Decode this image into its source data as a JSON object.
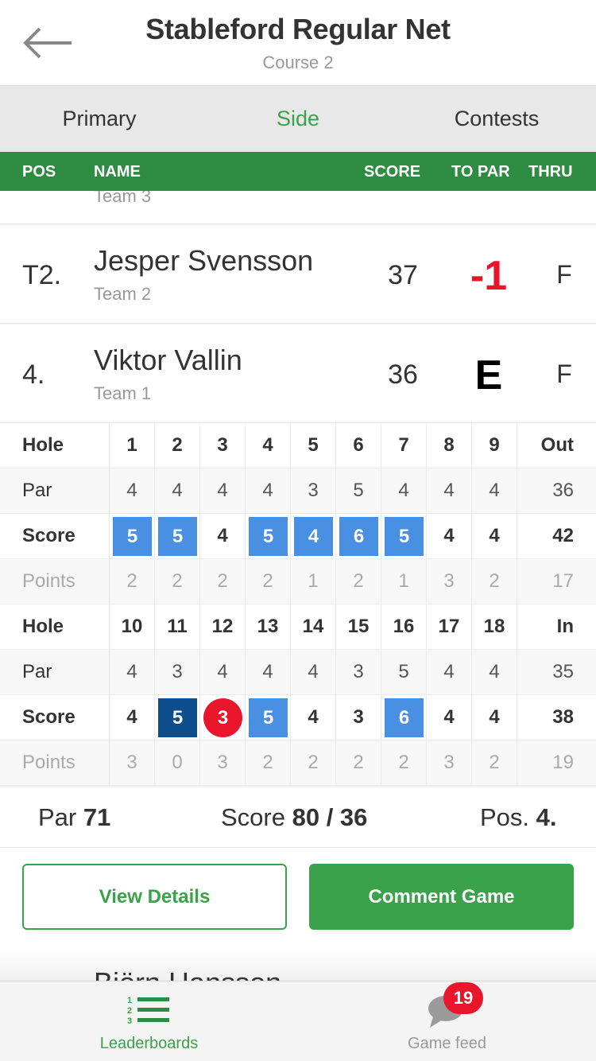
{
  "header": {
    "title": "Stableford Regular Net",
    "subtitle": "Course 2"
  },
  "tabs": [
    {
      "label": "Primary",
      "active": false
    },
    {
      "label": "Side",
      "active": true
    },
    {
      "label": "Contests",
      "active": false
    }
  ],
  "columns": {
    "pos": "POS",
    "name": "NAME",
    "score": "SCORE",
    "to_par": "TO PAR",
    "thru": "THRU"
  },
  "leaderboard": {
    "partial_team": "Team 3",
    "rows": [
      {
        "pos": "T2.",
        "name": "Jesper Svensson",
        "team": "Team 2",
        "score": "37",
        "to_par": "-1",
        "to_par_color": "#e8152b",
        "thru": "F"
      },
      {
        "pos": "4.",
        "name": "Viktor Vallin",
        "team": "Team 1",
        "score": "36",
        "to_par": "E",
        "to_par_color": "#000000",
        "thru": "F"
      }
    ],
    "next_player": "Björn Hansson"
  },
  "scorecard": {
    "front": {
      "hole_label": "Hole",
      "holes": [
        "1",
        "2",
        "3",
        "4",
        "5",
        "6",
        "7",
        "8",
        "9"
      ],
      "hole_total": "Out",
      "par_label": "Par",
      "par": [
        "4",
        "4",
        "4",
        "4",
        "3",
        "5",
        "4",
        "4",
        "4"
      ],
      "par_total": "36",
      "score_label": "Score",
      "score": [
        "5",
        "5",
        "4",
        "5",
        "4",
        "6",
        "5",
        "4",
        "4"
      ],
      "score_marks": [
        "bogey",
        "bogey",
        "",
        "bogey",
        "bogey",
        "bogey",
        "bogey",
        "",
        ""
      ],
      "score_total": "42",
      "points_label": "Points",
      "points": [
        "2",
        "2",
        "2",
        "2",
        "1",
        "2",
        "1",
        "3",
        "2"
      ],
      "points_total": "17"
    },
    "back": {
      "hole_label": "Hole",
      "holes": [
        "10",
        "11",
        "12",
        "13",
        "14",
        "15",
        "16",
        "17",
        "18"
      ],
      "hole_total": "In",
      "par_label": "Par",
      "par": [
        "4",
        "3",
        "4",
        "4",
        "4",
        "3",
        "5",
        "4",
        "4"
      ],
      "par_total": "35",
      "score_label": "Score",
      "score": [
        "4",
        "5",
        "3",
        "5",
        "4",
        "3",
        "6",
        "4",
        "4"
      ],
      "score_marks": [
        "",
        "double",
        "birdie",
        "bogey",
        "",
        "",
        "bogey",
        "",
        ""
      ],
      "score_total": "38",
      "points_label": "Points",
      "points": [
        "3",
        "0",
        "3",
        "2",
        "2",
        "2",
        "2",
        "3",
        "2"
      ],
      "points_total": "19"
    },
    "mark_colors": {
      "bogey": "#4a90e2",
      "double": "#0d4d8c",
      "birdie": "#e8152b"
    }
  },
  "summary": {
    "par_label": "Par",
    "par_value": "71",
    "score_label": "Score",
    "score_value": "80 / 36",
    "pos_label": "Pos.",
    "pos_value": "4."
  },
  "buttons": {
    "view_details": "View Details",
    "comment_game": "Comment Game"
  },
  "bottom_nav": {
    "leaderboards": "Leaderboards",
    "game_feed": "Game feed",
    "game_feed_badge": "19"
  },
  "colors": {
    "accent": "#3aa24a",
    "header_bar": "#2e8b42",
    "negative": "#e8152b"
  }
}
